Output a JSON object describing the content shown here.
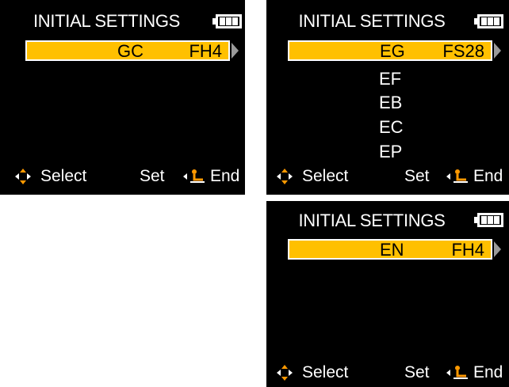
{
  "screen1": {
    "title": "INITIAL SETTINGS",
    "selected": {
      "code": "GC",
      "value": "FH4"
    },
    "footer": {
      "select": "Select",
      "set": "Set",
      "end": "End"
    }
  },
  "screen2": {
    "title": "INITIAL SETTINGS",
    "selected": {
      "code": "EG",
      "value": "FS28"
    },
    "options": [
      "EF",
      "EB",
      "EC",
      "EP"
    ],
    "footer": {
      "select": "Select",
      "set": "Set",
      "end": "End"
    }
  },
  "screen3": {
    "title": "INITIAL SETTINGS",
    "selected": {
      "code": "EN",
      "value": "FH4"
    },
    "footer": {
      "select": "Select",
      "set": "Set",
      "end": "End"
    }
  },
  "colors": {
    "highlight": "#ffc000",
    "background": "#000000",
    "dpad": "#ff9900",
    "text": "#ffffff"
  },
  "icons": [
    "battery-icon",
    "dpad-icon",
    "end-return-icon",
    "scroll-right-arrow-icon"
  ]
}
